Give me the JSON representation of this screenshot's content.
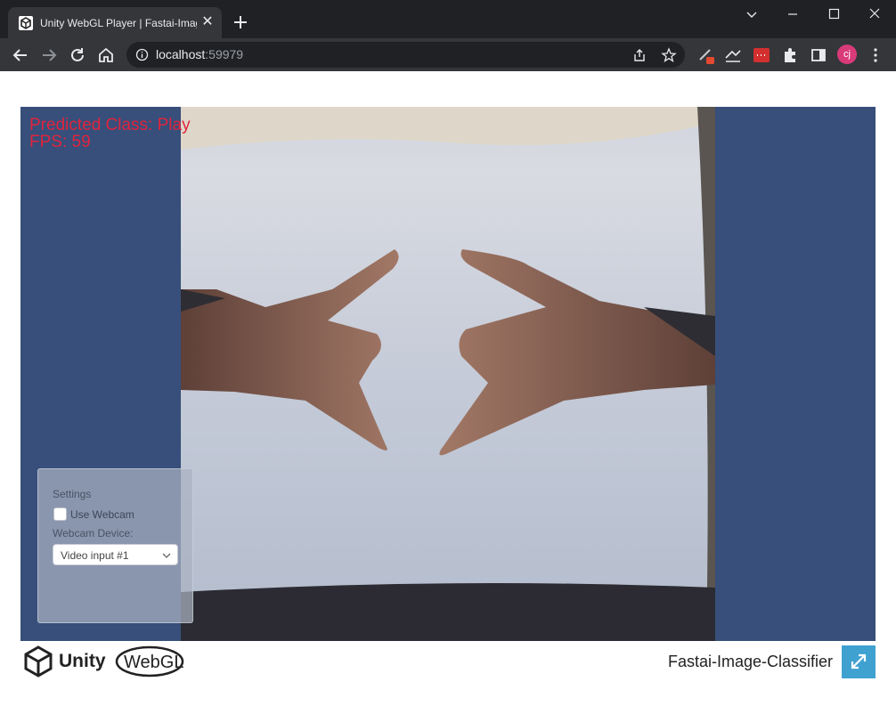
{
  "browser": {
    "tab_title": "Unity WebGL Player | Fastai-Image-Classifier",
    "tab_close_glyph": "✕",
    "url_host": "localhost",
    "url_port": ":59979",
    "profile_initials": "cj"
  },
  "hud": {
    "predicted_class": "Predicted Class: Play",
    "fps": "FPS: 59"
  },
  "settings": {
    "title": "Settings",
    "use_webcam_label": "Use Webcam",
    "use_webcam_checked": false,
    "device_label": "Webcam Device:",
    "device_value": "Video input #1"
  },
  "footer": {
    "brand": "Unity",
    "platform": "WebGL",
    "project_title": "Fastai-Image-Classifier"
  },
  "colors": {
    "canvas_bg": "#374f7a",
    "hud_text": "#e0243e",
    "fullscreen_btn": "#3fa1d0",
    "chrome_dark": "#202124",
    "chrome_toolbar": "#35363a"
  }
}
